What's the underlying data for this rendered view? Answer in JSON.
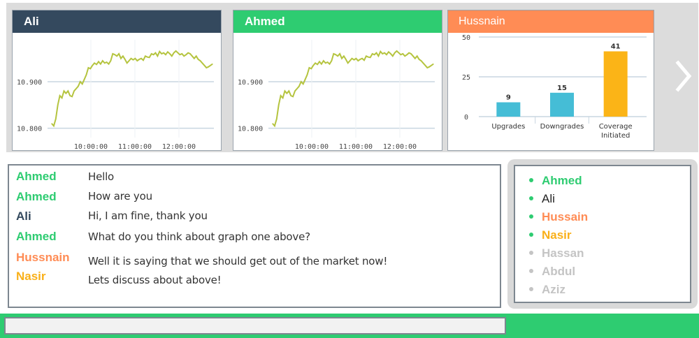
{
  "colors": {
    "dark_header": "#34495e",
    "green": "#2ecc71",
    "orange": "#ff8c55",
    "yellow": "#f9b019",
    "gray_user": "#c4c4c4",
    "line_series": "#b5c43f",
    "bar_blue": "#45bdd6",
    "bar_yellow": "#fbb417"
  },
  "panels": [
    {
      "title": "Ali",
      "header_color": "#34495e",
      "chart_data": {
        "type": "line",
        "y_ticks": [
          "10.900",
          "10.800"
        ],
        "x_ticks": [
          "10:00:00",
          "11:00:00",
          "12:00:00"
        ],
        "ylim": [
          10.78,
          10.99
        ],
        "series": [
          {
            "color": "#b5c43f",
            "x": [
              0,
              1,
              2,
              3,
              4,
              5,
              6,
              7,
              8,
              9,
              10,
              11,
              12,
              13,
              14,
              15,
              16,
              17,
              18,
              19,
              20,
              21,
              22,
              23,
              24,
              25,
              26,
              27,
              28,
              29,
              30,
              31,
              32,
              33,
              34,
              35,
              36,
              37,
              38,
              39,
              40,
              41,
              42,
              43,
              44,
              45,
              46,
              47,
              48,
              49,
              50,
              51,
              52,
              53,
              54,
              55,
              56,
              57,
              58,
              59,
              60,
              61,
              62,
              63,
              64,
              65,
              66,
              67,
              68,
              69,
              70,
              71,
              72,
              73,
              74,
              75,
              76,
              77,
              78,
              79
            ],
            "y": [
              10.81,
              10.805,
              10.82,
              10.85,
              10.87,
              10.865,
              10.88,
              10.875,
              10.88,
              10.87,
              10.868,
              10.88,
              10.885,
              10.89,
              10.9,
              10.895,
              10.905,
              10.915,
              10.93,
              10.928,
              10.935,
              10.94,
              10.937,
              10.943,
              10.938,
              10.945,
              10.94,
              10.942,
              10.938,
              10.945,
              10.96,
              10.958,
              10.955,
              10.96,
              10.95,
              10.955,
              10.948,
              10.94,
              10.945,
              10.95,
              10.947,
              10.95,
              10.945,
              10.948,
              10.95,
              10.946,
              10.955,
              10.953,
              10.952,
              10.96,
              10.958,
              10.962,
              10.955,
              10.965,
              10.96,
              10.962,
              10.958,
              10.964,
              10.96,
              10.955,
              10.962,
              10.966,
              10.962,
              10.958,
              10.96,
              10.955,
              10.958,
              10.962,
              10.96,
              10.955,
              10.95,
              10.955,
              10.948,
              10.945,
              10.94,
              10.935,
              10.93,
              10.932,
              10.935,
              10.938
            ]
          }
        ]
      }
    },
    {
      "title": "Ahmed",
      "header_color": "#2ecc71",
      "chart_data": {
        "type": "line",
        "y_ticks": [
          "10.900",
          "10.800"
        ],
        "x_ticks": [
          "10:00:00",
          "11:00:00",
          "12:00:00"
        ],
        "ylim": [
          10.78,
          10.99
        ],
        "series": [
          {
            "color": "#b5c43f",
            "x": [
              0,
              1,
              2,
              3,
              4,
              5,
              6,
              7,
              8,
              9,
              10,
              11,
              12,
              13,
              14,
              15,
              16,
              17,
              18,
              19,
              20,
              21,
              22,
              23,
              24,
              25,
              26,
              27,
              28,
              29,
              30,
              31,
              32,
              33,
              34,
              35,
              36,
              37,
              38,
              39,
              40,
              41,
              42,
              43,
              44,
              45,
              46,
              47,
              48,
              49,
              50,
              51,
              52,
              53,
              54,
              55,
              56,
              57,
              58,
              59,
              60,
              61,
              62,
              63,
              64,
              65,
              66,
              67,
              68,
              69,
              70,
              71,
              72,
              73,
              74,
              75,
              76,
              77,
              78,
              79
            ],
            "y": [
              10.81,
              10.805,
              10.82,
              10.85,
              10.87,
              10.865,
              10.88,
              10.875,
              10.88,
              10.87,
              10.868,
              10.88,
              10.885,
              10.89,
              10.9,
              10.895,
              10.905,
              10.915,
              10.93,
              10.928,
              10.935,
              10.94,
              10.937,
              10.943,
              10.938,
              10.945,
              10.94,
              10.942,
              10.938,
              10.945,
              10.96,
              10.958,
              10.955,
              10.96,
              10.95,
              10.955,
              10.948,
              10.94,
              10.945,
              10.95,
              10.947,
              10.95,
              10.945,
              10.948,
              10.95,
              10.946,
              10.955,
              10.953,
              10.952,
              10.96,
              10.958,
              10.962,
              10.955,
              10.965,
              10.96,
              10.962,
              10.958,
              10.964,
              10.96,
              10.955,
              10.962,
              10.966,
              10.962,
              10.958,
              10.96,
              10.955,
              10.958,
              10.962,
              10.96,
              10.955,
              10.95,
              10.955,
              10.948,
              10.945,
              10.94,
              10.935,
              10.93,
              10.932,
              10.935,
              10.938
            ]
          }
        ]
      }
    },
    {
      "title": "Hussnain",
      "header_color": "#ff8c55",
      "chart_data": {
        "type": "bar",
        "categories": [
          [
            "Upgrades"
          ],
          [
            "Downgrades"
          ],
          [
            "Coverage",
            "Initiated"
          ]
        ],
        "values": [
          9,
          15,
          41
        ],
        "colors": [
          "#45bdd6",
          "#45bdd6",
          "#fbb417"
        ],
        "y_ticks": [
          "50",
          "25",
          "0"
        ],
        "ylim": [
          0,
          50
        ]
      }
    }
  ],
  "next_icon": "chevron-right-icon",
  "chat": {
    "messages": [
      {
        "user": "Ahmed",
        "color": "#2ecc71",
        "text": "Hello"
      },
      {
        "user": "Ahmed",
        "color": "#2ecc71",
        "text": "How are you"
      },
      {
        "user": "Ali",
        "color": "#34495e",
        "text": "Hi, I am fine, thank you"
      },
      {
        "user": "Ahmed",
        "color": "#2ecc71",
        "text": "What do you think about graph one above?"
      },
      {
        "user": "Hussnain",
        "color": "#ff8c55",
        "text": "Well it is saying that we should get out of the market now!"
      },
      {
        "user": "Nasir",
        "color": "#f9b019",
        "text": "Lets discuss about above!"
      }
    ]
  },
  "users": [
    {
      "name": "Ahmed",
      "color": "#2ecc71",
      "dot": "#2ecc71",
      "bold": true
    },
    {
      "name": "Ali",
      "color": "#222222",
      "dot": "#2ecc71",
      "bold": false
    },
    {
      "name": "Hussain",
      "color": "#ff8c55",
      "dot": "#2ecc71",
      "bold": true
    },
    {
      "name": "Nasir",
      "color": "#f9b019",
      "dot": "#2ecc71",
      "bold": true
    },
    {
      "name": "Hassan",
      "color": "#c4c4c4",
      "dot": "#c4c4c4",
      "bold": true
    },
    {
      "name": "Abdul",
      "color": "#c4c4c4",
      "dot": "#c4c4c4",
      "bold": true
    },
    {
      "name": "Aziz",
      "color": "#c4c4c4",
      "dot": "#c4c4c4",
      "bold": true
    }
  ],
  "input": {
    "value": "",
    "placeholder": ""
  }
}
